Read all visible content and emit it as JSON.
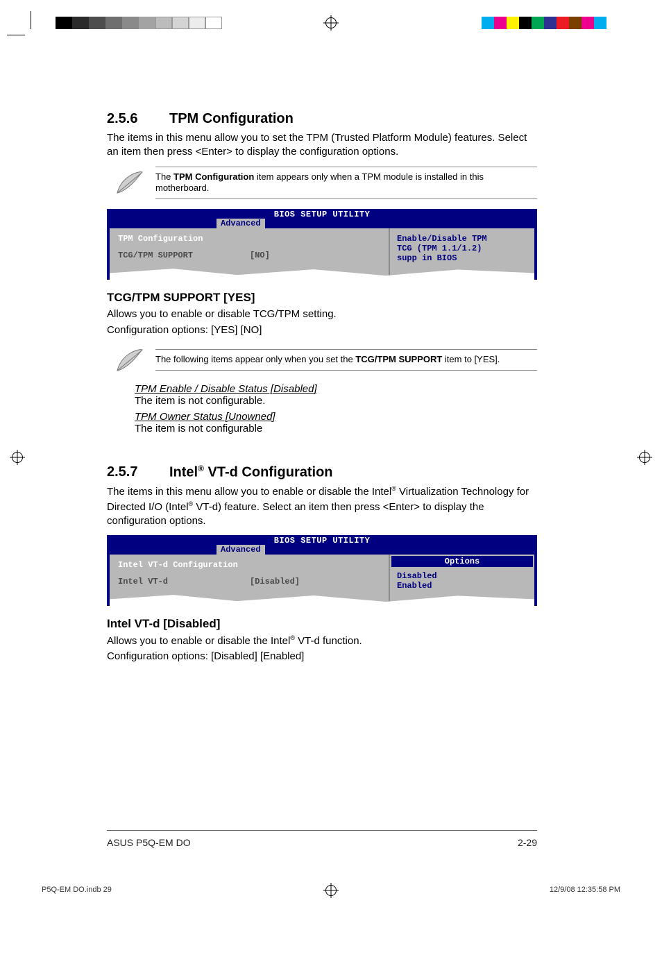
{
  "registration": {
    "grayscale": [
      "#000000",
      "#1a1a1a",
      "#333333",
      "#4d4d4d",
      "#666666",
      "#808080",
      "#999999",
      "#b3b3b3",
      "#cccccc",
      "#e6e6e6",
      "#ffffff"
    ],
    "cmyk": [
      "#00AEEF",
      "#EC008C",
      "#FFF200",
      "#000000",
      "#00A651",
      "#2E3192",
      "#ED1C24",
      "#F7941D",
      "#EC008C",
      "#00AEEF"
    ]
  },
  "section256": {
    "num": "2.5.6",
    "title": "TPM Configuration",
    "intro": "The items in this menu allow you to set the TPM (Trusted Platform Module) features. Select an item then press <Enter> to display the configuration options.",
    "note_prefix": "The ",
    "note_bold": "TPM Configuration",
    "note_suffix": " item appears only when a TPM module is installed in this motherboard.",
    "bios": {
      "title": "BIOS SETUP UTILITY",
      "tab": "Advanced",
      "left_heading": "TPM Configuration",
      "row_key": "TCG/TPM SUPPORT",
      "row_val": "[NO]",
      "right_l1": "Enable/Disable TPM",
      "right_l2": "TCG (TPM 1.1/1.2)",
      "right_l3": "supp in BIOS"
    },
    "h3": "TCG/TPM SUPPORT [YES]",
    "h3_desc1": "Allows you to enable or disable TCG/TPM setting.",
    "h3_desc2": "Configuration options: [YES] [NO]",
    "note2_prefix": "The following items appear only when you set the ",
    "note2_bold": "TCG/TPM SUPPORT",
    "note2_suffix": " item to [YES].",
    "sub1_t": "TPM Enable / Disable Status [Disabled]",
    "sub1_d": "The item is not configurable.",
    "sub2_t": "TPM Owner Status [Unowned]",
    "sub2_d": "The item is not configurable"
  },
  "section257": {
    "num": "2.5.7",
    "title_pre": "Intel",
    "title_sup": "®",
    "title_post": " VT-d Configuration",
    "intro_1": "The items in this menu allow you to enable or disable the Intel",
    "intro_sup1": "®",
    "intro_2": " Virtualization Technology for Directed I/O (Intel",
    "intro_sup2": "®",
    "intro_3": " VT-d) feature. Select an item then press <Enter> to display the configuration options.",
    "bios": {
      "title": "BIOS SETUP UTILITY",
      "tab": "Advanced",
      "left_heading": "Intel VT-d Configuration",
      "row_key": "Intel VT-d",
      "row_val": "[Disabled]",
      "opt_hdr": "Options",
      "opt1": "Disabled",
      "opt2": "Enabled"
    },
    "h3": "Intel VT-d [Disabled]",
    "h3_desc1_pre": "Allows you to enable or disable the Intel",
    "h3_desc1_sup": "®",
    "h3_desc1_post": " VT-d function.",
    "h3_desc2": "Configuration options: [Disabled] [Enabled]"
  },
  "footer": {
    "left": "ASUS P5Q-EM DO",
    "right": "2-29"
  },
  "slug": {
    "file": "P5Q-EM DO.indb   29",
    "stamp": "12/9/08   12:35:58 PM"
  }
}
